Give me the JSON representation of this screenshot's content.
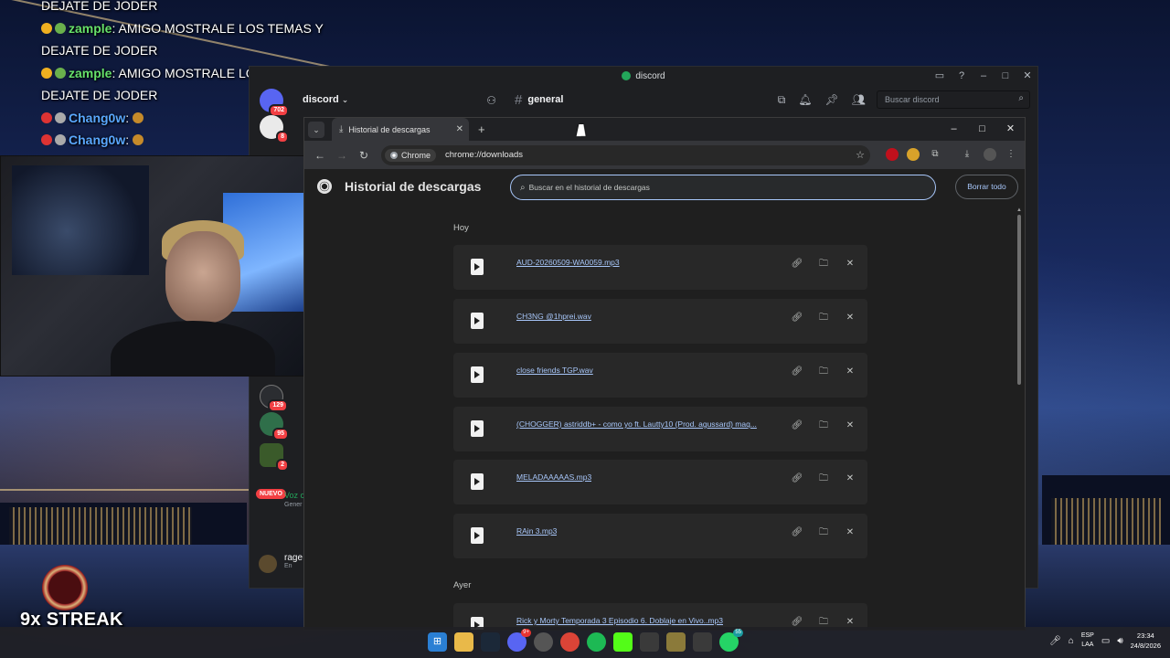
{
  "stream": {
    "chat": [
      {
        "user": "",
        "text": "DEJATE DE JODER"
      },
      {
        "user": "zample",
        "text": ": AMIGO MOSTRALE LOS TEMAS Y"
      },
      {
        "user": "",
        "text": "DEJATE DE JODER"
      },
      {
        "user": "zample",
        "text": ": AMIGO MOSTRALE LOS TEMAS Y"
      },
      {
        "user": "",
        "text": "DEJATE DE JODER"
      },
      {
        "user": "Chang0w",
        "text": ":"
      },
      {
        "user": "Chang0w",
        "text": ":"
      }
    ],
    "streak": "9x STREAK"
  },
  "discord": {
    "title": "discord",
    "server_name": "discord",
    "channel": "general",
    "search_placeholder": "Buscar discord",
    "server_badges": [
      "702",
      "8",
      "129",
      "95",
      "2"
    ],
    "nuevo_label": "NUEVO",
    "voice": {
      "label": "Voz c",
      "sub": "Gener"
    },
    "user": {
      "name": "rage",
      "status": "En"
    }
  },
  "chrome": {
    "tab_title": "Historial de descargas",
    "chip_label": "Chrome",
    "url": "chrome://downloads",
    "page_title": "Historial de descargas",
    "search_placeholder": "Buscar en el historial de descargas",
    "clear_all": "Borrar todo",
    "sections": {
      "today": "Hoy",
      "yesterday": "Ayer"
    },
    "today_items": [
      {
        "name": "AUD-20260509-WA0059.mp3"
      },
      {
        "name": "CH3NG @1hprei.wav"
      },
      {
        "name": "close friends TGP.wav"
      },
      {
        "name": "(CHOGGER) astriddb+ - como yo ft. Lautty10 (Prod. agussard) maq..."
      },
      {
        "name": "MELADAAAAAS.mp3"
      },
      {
        "name": "RAin 3.mp3"
      }
    ],
    "yesterday_items": [
      {
        "name": "Rick y Morty Temporada 3 Episodio 6. Doblaje en Vivo..mp3"
      }
    ]
  },
  "taskbar": {
    "badges": {
      "discord": "9+",
      "whatsapp": "55"
    },
    "lang": {
      "line1": "ESP",
      "line2": "LAA"
    },
    "clock": {
      "time": "23:34",
      "date": "24/8/2026"
    }
  }
}
